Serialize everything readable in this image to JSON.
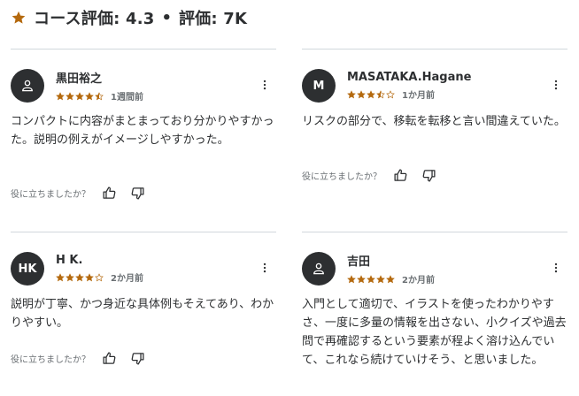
{
  "header": {
    "title": "コース評価: 4.3",
    "separator": "•",
    "count": "評価: 7K",
    "star_icon": "star-icon",
    "accent_color": "#b4690e"
  },
  "helpful_prompt": "役に立ちましたか？",
  "reviews": [
    {
      "avatar_text": "",
      "avatar_icon": "user-icon",
      "name": "黒田裕之",
      "rating": 4.5,
      "date": "1週間前",
      "body": "コンパクトに内容がまとまっており分かりやすかった。説明の例えがイメージしやすかった。"
    },
    {
      "avatar_text": "M",
      "name": "MASATAKA.Hagane",
      "rating": 3.5,
      "date": "1か月前",
      "body": "リスクの部分で、移転を転移と言い間違えていた。"
    },
    {
      "avatar_text": "HK",
      "name": "H K.",
      "rating": 4,
      "date": "2か月前",
      "body": "説明が丁寧、かつ身近な具体例もそえてあり、わかりやすい。"
    },
    {
      "avatar_text": "",
      "avatar_icon": "user-icon",
      "name": "吉田",
      "rating": 5,
      "date": "2か月前",
      "body": "入門として適切で、イラストを使ったわかりやすさ、一度に多量の情報を出さない、小クイズや過去問で再確認するという要素が程よく溶け込んでいて、これなら続けていけそう、と思いました。"
    }
  ],
  "colors": {
    "star_fill": "#b4690e",
    "text": "#2d2f31",
    "muted": "#6a6f73",
    "divider": "#d1d7dc"
  }
}
